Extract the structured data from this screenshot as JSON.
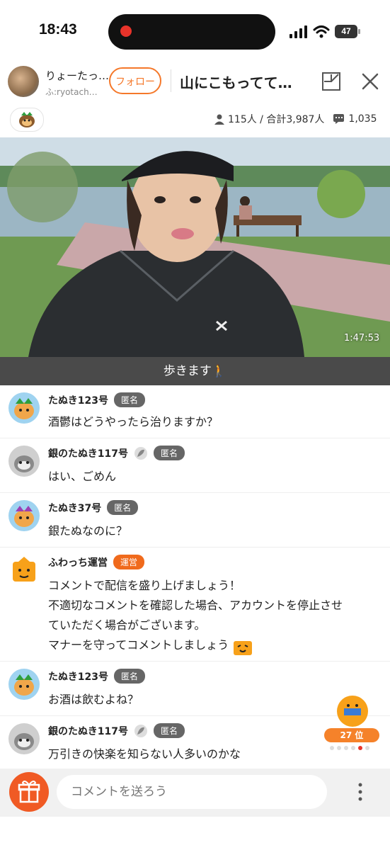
{
  "status_bar": {
    "time": "18:43",
    "battery": "47"
  },
  "header": {
    "host_name": "りょーたっ…",
    "host_id": "ふ:ryotach…",
    "follow_label": "フォロー",
    "title": "山にこもってて…"
  },
  "stats": {
    "viewers": "115人 / 合計3,987人",
    "comments": "1,035"
  },
  "video": {
    "duration": "1:47:53",
    "caption": "歩きます🚶"
  },
  "comments": [
    {
      "name": "たぬき123号",
      "badge": "匿名",
      "text": "酒鬱はどうやったら治りますか？"
    },
    {
      "name": "銀のたぬき117号",
      "badge": "匿名",
      "text": "はい、ごめん"
    },
    {
      "name": "たぬき37号",
      "badge": "匿名",
      "text": "銀たぬなのに？"
    },
    {
      "name": "ふわっち運営",
      "badge": "運営",
      "line1": "コメントで配信を盛り上げましょう！",
      "line2": "不適切なコメントを確認した場合、アカウントを停止させ",
      "line3": "ていただく場合がございます。",
      "line4": "マナーを守ってコメントしましょう"
    },
    {
      "name": "たぬき123号",
      "badge": "匿名",
      "text": "お酒は飲むよね？"
    },
    {
      "name": "銀のたぬき117号",
      "badge": "匿名",
      "text": "万引きの快楽を知らない人多いのかな"
    }
  ],
  "ranking": {
    "label": "27 位"
  },
  "input": {
    "placeholder": "コメントを送ろう"
  },
  "colors": {
    "accent": "#f5782a",
    "anon_badge": "#666666",
    "official_badge": "#f06a1c"
  }
}
